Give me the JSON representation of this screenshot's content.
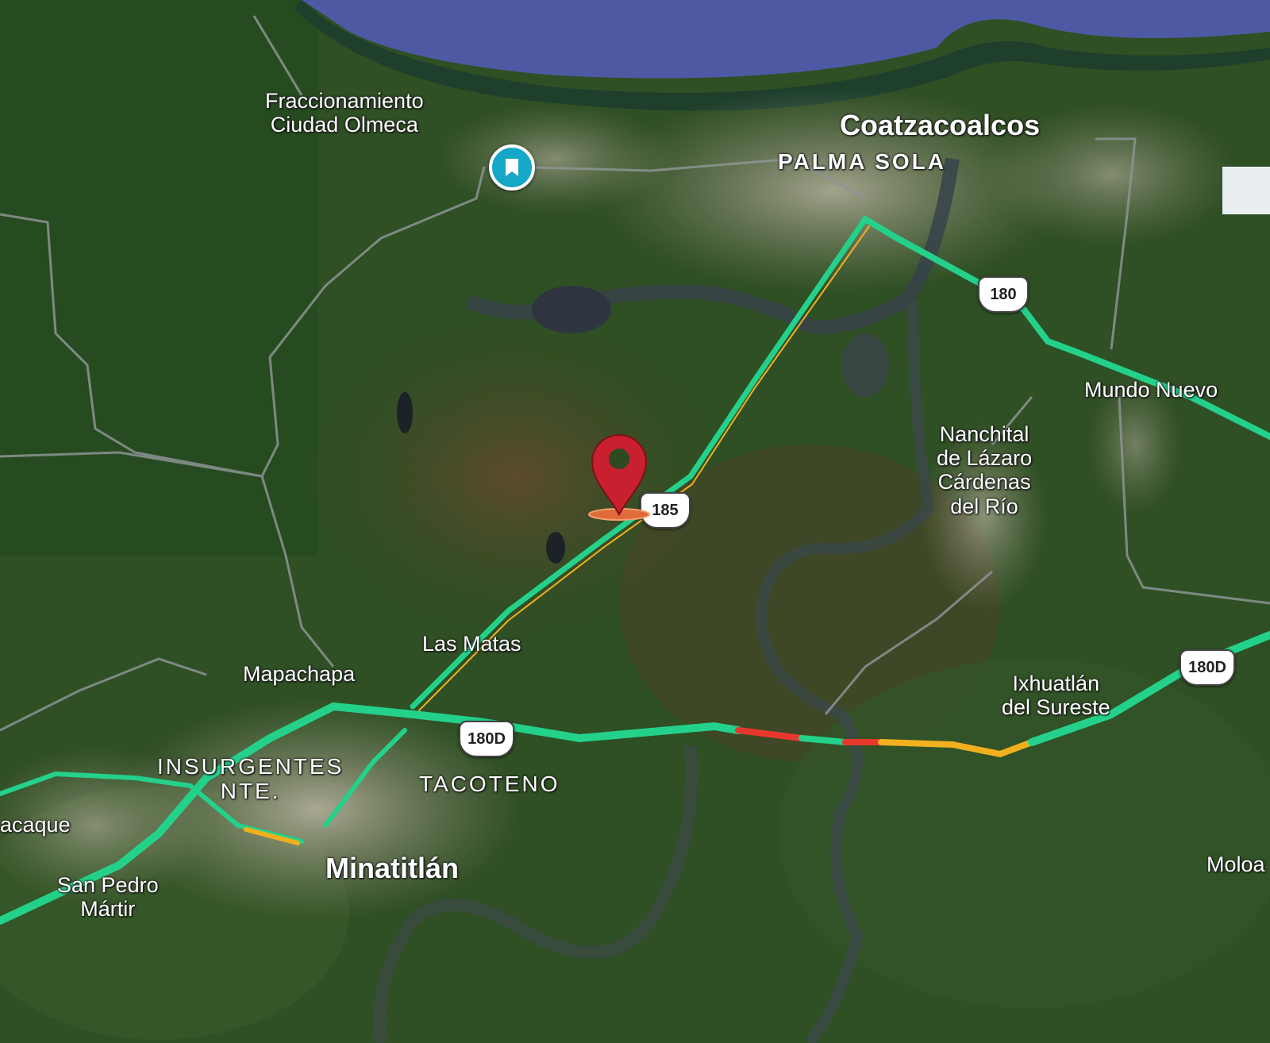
{
  "map": {
    "type": "satellite",
    "labels": {
      "fraccionamiento": "Fraccionamiento\nCiudad Olmeca",
      "coatzacoalcos": "Coatzacoalcos",
      "palma_sola": "PALMA SOLA",
      "mundo_nuevo": "Mundo Nuevo",
      "nanchital": "Nanchital\nde Lázaro\nCárdenas\ndel Río",
      "las_matas": "Las Matas",
      "mapachapa": "Mapachapa",
      "insurgentes": "INSURGENTES\nNTE.",
      "tacoteno": "TACOTENO",
      "ixhuatlan": "Ixhuatlán\ndel Sureste",
      "cosoleacaque": "acaque",
      "san_pedro": "San Pedro\nMártir",
      "minatitlan": "Minatitlán",
      "moloacan": "Moloa"
    },
    "shields": {
      "r180": "180",
      "r185": "185",
      "r180d_east": "180D",
      "r180d_west": "180D"
    },
    "colors": {
      "traffic_fast": "#23d18b",
      "traffic_slow": "#f2b01e",
      "traffic_jam": "#e8382d",
      "sea": "#4d5aa3",
      "pin": "#c8202e",
      "bookmark": "#15a7c7"
    },
    "markers": {
      "bookmark_icon": "bookmark-icon",
      "pin_icon": "location-pin-icon"
    }
  }
}
